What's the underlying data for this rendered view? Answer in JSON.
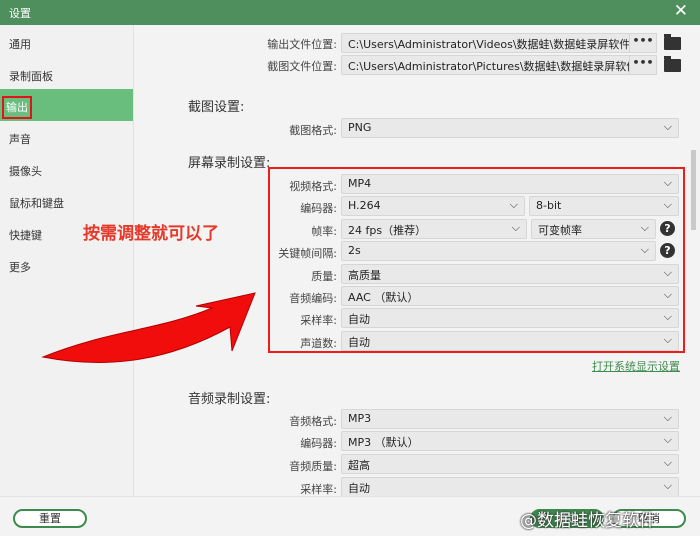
{
  "window": {
    "title": "设置",
    "close": "✕"
  },
  "sidebar": {
    "items": [
      {
        "label": "通用"
      },
      {
        "label": "录制面板"
      },
      {
        "label": "输出",
        "selected": true
      },
      {
        "label": "声音"
      },
      {
        "label": "摄像头"
      },
      {
        "label": "鼠标和键盘"
      },
      {
        "label": "快捷键"
      },
      {
        "label": "更多"
      }
    ]
  },
  "paths": {
    "output_label": "输出文件位置:",
    "output_value": "C:\\Users\\Administrator\\Videos\\数据蛙\\数据蛙录屏软件",
    "shot_label": "截图文件位置:",
    "shot_value": "C:\\Users\\Administrator\\Pictures\\数据蛙\\数据蛙录屏软件",
    "browse": "•••"
  },
  "screenshot": {
    "heading": "截图设置:",
    "format_label": "截图格式:",
    "format_value": "PNG"
  },
  "screen": {
    "heading": "屏幕录制设置:",
    "video_format_label": "视频格式:",
    "video_format": "MP4",
    "encoder_label": "编码器:",
    "encoder": "H.264",
    "bitdepth": "8-bit",
    "fps_label": "帧率:",
    "fps": "24 fps（推荐）",
    "fps_mode": "可变帧率",
    "keyframe_label": "关键帧间隔:",
    "keyframe": "2s",
    "quality_label": "质量:",
    "quality": "高质量",
    "audio_codec_label": "音频编码:",
    "audio_codec": "AAC （默认）",
    "sample_label": "采样率:",
    "sample": "自动",
    "channels_label": "声道数:",
    "channels": "自动",
    "display_link": "打开系统显示设置"
  },
  "audio": {
    "heading": "音频录制设置:",
    "format_label": "音频格式:",
    "format": "MP3",
    "encoder_label": "编码器:",
    "encoder": "MP3 （默认）",
    "quality_label": "音频质量:",
    "quality": "超高",
    "sample_label": "采样率:",
    "sample": "自动"
  },
  "annotation": {
    "text": "按需调整就可以了",
    "color": "#e53a2b"
  },
  "footer": {
    "reset": "重置",
    "ok": "确定",
    "cancel": "取消"
  },
  "watermark": "@数据蛙恢复软件",
  "colors": {
    "accent": "#4f8e5d",
    "selected": "#69be7e",
    "highlight": "#ef1c1c"
  },
  "icons": {
    "chevron": "⌵",
    "help": "?"
  }
}
